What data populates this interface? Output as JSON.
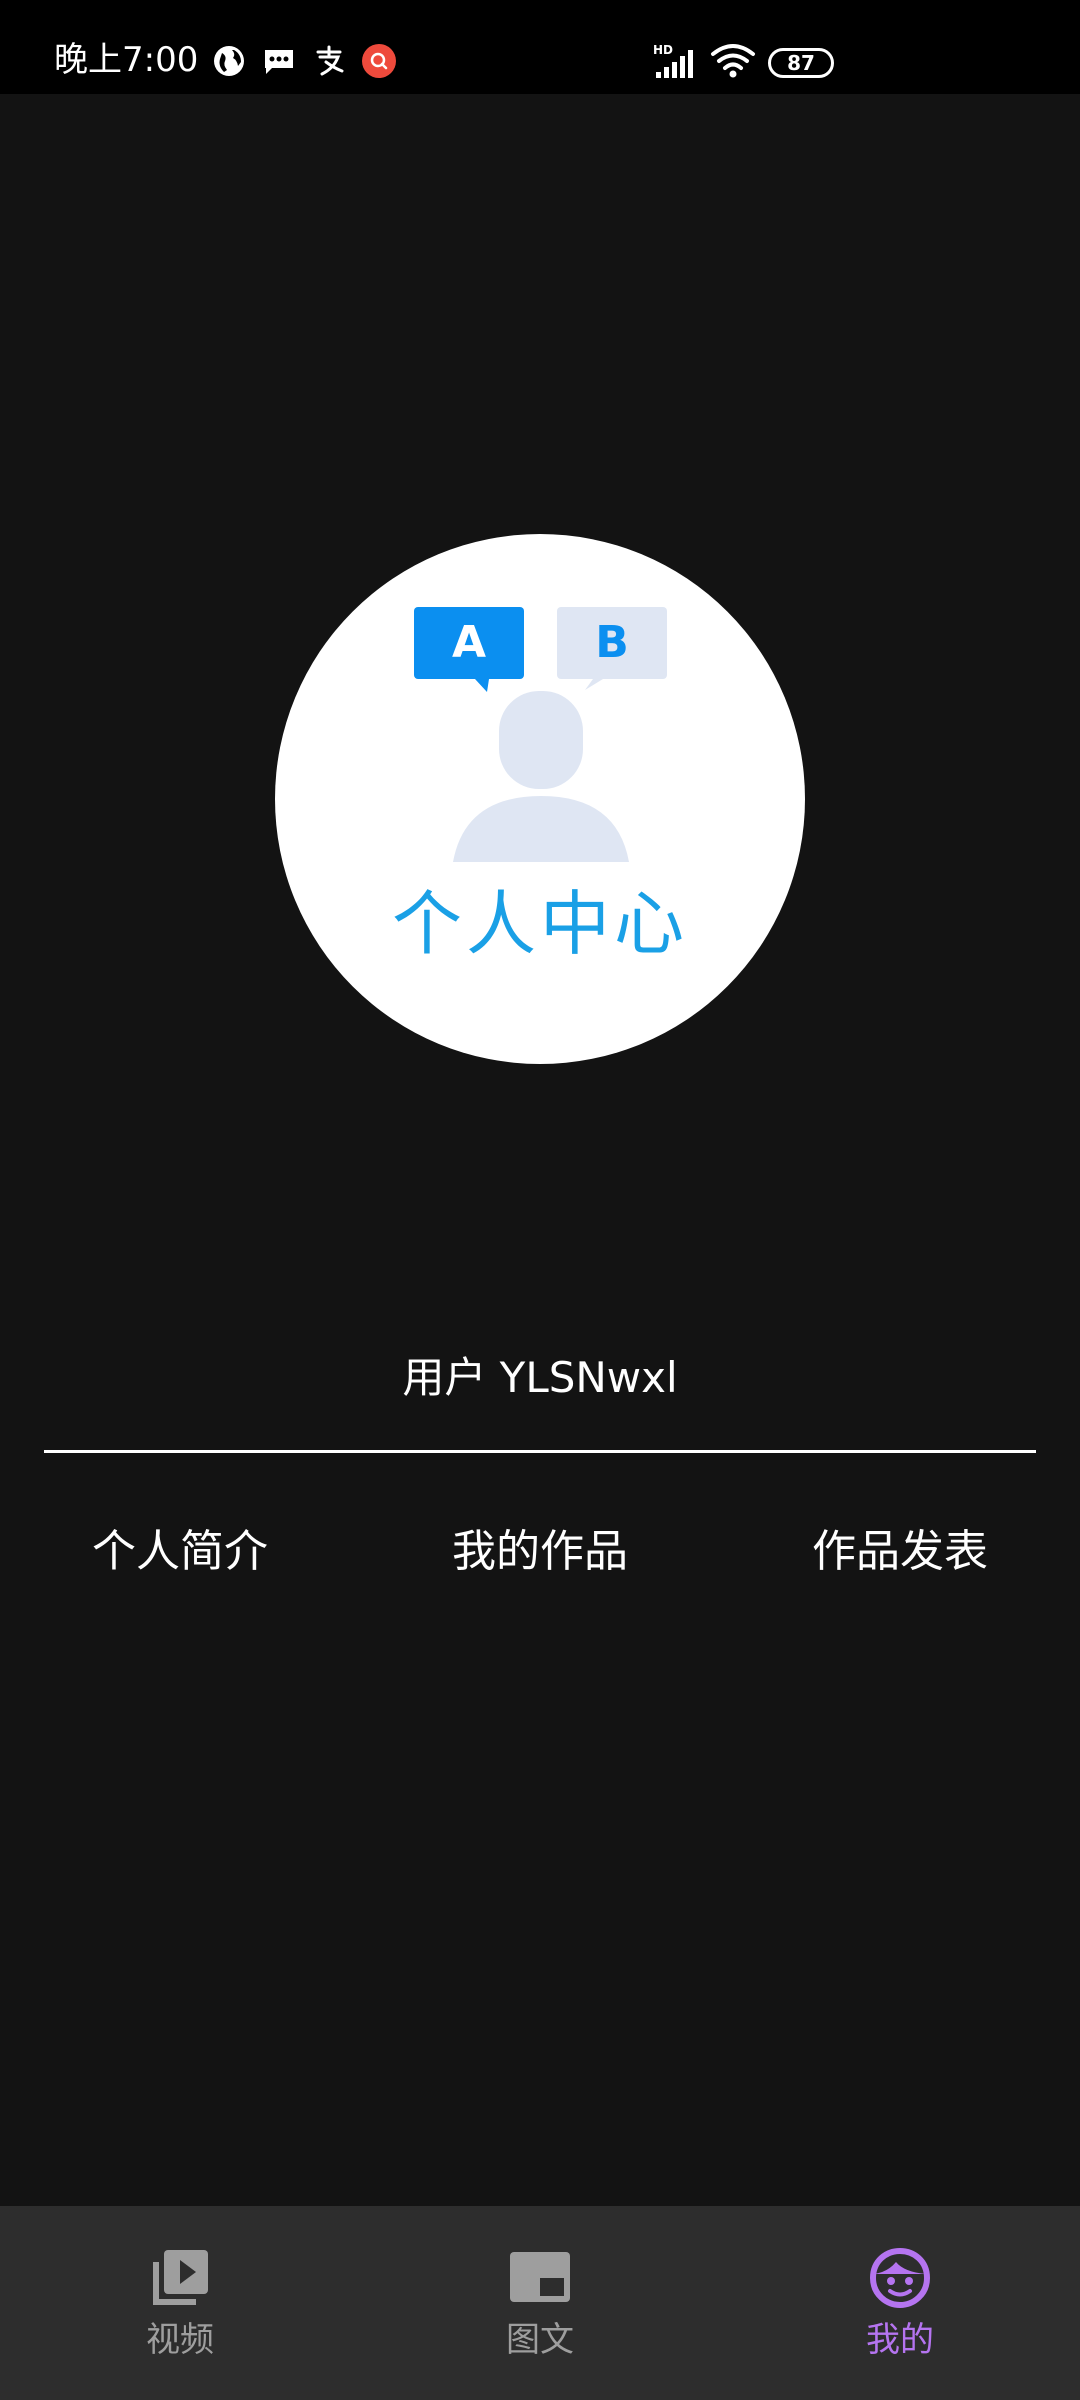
{
  "status_bar": {
    "time": "晚上7:00",
    "battery": "87",
    "icons": [
      "globe-icon",
      "message-icon",
      "alipay-icon",
      "search-app-icon",
      "hd-signal-icon",
      "wifi-icon",
      "battery-icon"
    ]
  },
  "profile": {
    "avatar_caption": "个人中心",
    "avatar_badges": [
      "A",
      "B"
    ],
    "username": "用户 YLSNwxl"
  },
  "menu": {
    "items": [
      {
        "label": "个人简介"
      },
      {
        "label": "我的作品"
      },
      {
        "label": "作品发表"
      }
    ]
  },
  "bottom_nav": {
    "items": [
      {
        "label": "视频",
        "icon": "video-library-icon"
      },
      {
        "label": "图文",
        "icon": "picture-in-picture-icon"
      },
      {
        "label": "我的",
        "icon": "face-icon",
        "active": true
      }
    ],
    "active_color": "#b574f0",
    "inactive_color": "#9e9e9e"
  },
  "colors": {
    "background": "#131313",
    "status_bar": "#000000",
    "nav_background": "#2d2d2d",
    "avatar_accent": "#1aa0e6"
  }
}
